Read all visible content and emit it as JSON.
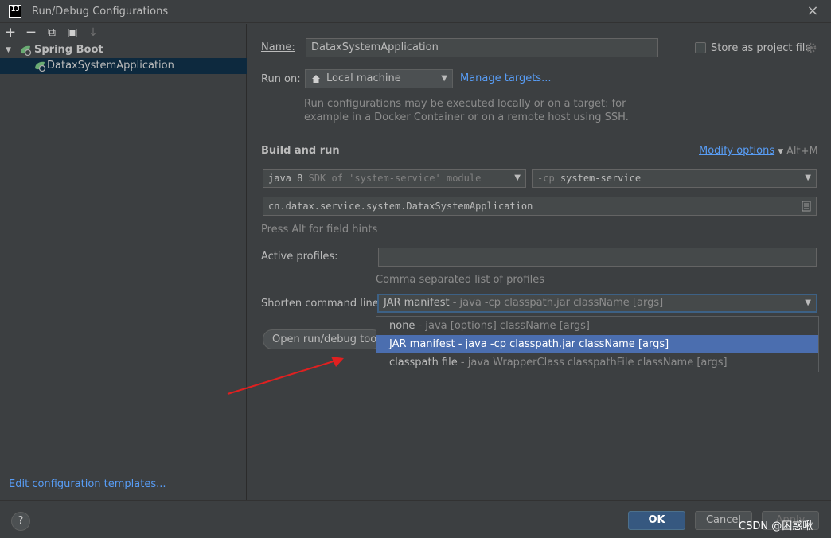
{
  "window": {
    "logo": "IJ",
    "title": "Run/Debug Configurations",
    "close_icon": "×"
  },
  "toolbar": {
    "add": "+",
    "remove": "−",
    "copy": "⧉",
    "folder": "▣",
    "sort": "↓"
  },
  "tree": {
    "group_label": "Spring Boot",
    "item_label": "DataxSystemApplication"
  },
  "edit_templates": "Edit configuration templates...",
  "form": {
    "name_label": "Name:",
    "name_value": "DataxSystemApplication",
    "store_label": "Store as project file",
    "run_on_label": "Run on:",
    "run_on_value": "Local machine",
    "manage_targets": "Manage targets...",
    "run_on_hint_line1": "Run configurations may be executed locally or on a target: for",
    "run_on_hint_line2": "example in a Docker Container or on a remote host using SSH.",
    "build_and_run": "Build and run",
    "modify_options": "Modify options",
    "modify_shortcut": "Alt+M",
    "sdk_main": "java 8",
    "sdk_hint": "SDK of 'system-service' module",
    "cp_prefix": "-cp",
    "cp_value": "system-service",
    "main_class": "cn.datax.service.system.DataxSystemApplication",
    "alt_hint": "Press Alt for field hints",
    "active_profiles_label": "Active profiles:",
    "active_profiles_value": "",
    "profiles_hint": "Comma separated list of profiles",
    "shorten_label": "Shorten command line:",
    "shorten_value": "JAR manifest",
    "shorten_value_hint": "- java -cp classpath.jar className [args]",
    "open_tool_window": "Open run/debug tool"
  },
  "dropdown": {
    "options": [
      {
        "name": "none",
        "hint": "- java [options] className [args]"
      },
      {
        "name": "JAR manifest",
        "hint": "- java -cp classpath.jar className [args]"
      },
      {
        "name": "classpath file",
        "hint": "- java WrapperClass classpathFile className [args]"
      }
    ],
    "selected_index": 1
  },
  "buttons": {
    "help": "?",
    "ok": "OK",
    "cancel": "Cancel",
    "apply": "Apply"
  },
  "watermark": "CSDN @困惑啾",
  "colors": {
    "accent": "#4b6eaf",
    "link": "#589df6",
    "spring": "#6aab73",
    "arrow": "#e02020"
  }
}
